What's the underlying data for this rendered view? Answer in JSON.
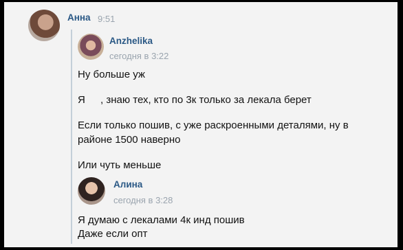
{
  "message": {
    "author": "Анна",
    "time": "9:51",
    "forwarded": [
      {
        "author": "Anzhelika",
        "time": "сегодня в 3:22",
        "lines": [
          "Ну больше уж",
          "Я",
          ", знаю тех, кто по 3к только за лекала берет",
          "Если только пошив, с уже раскроенными деталями, ну в",
          "районе 1500 наверно",
          "Или чуть меньше"
        ]
      },
      {
        "author": "Алина",
        "time": "сегодня в 3:28",
        "lines": [
          "Я думаю с лекалами 4к инд пошив",
          "Даже если опт"
        ]
      }
    ]
  }
}
